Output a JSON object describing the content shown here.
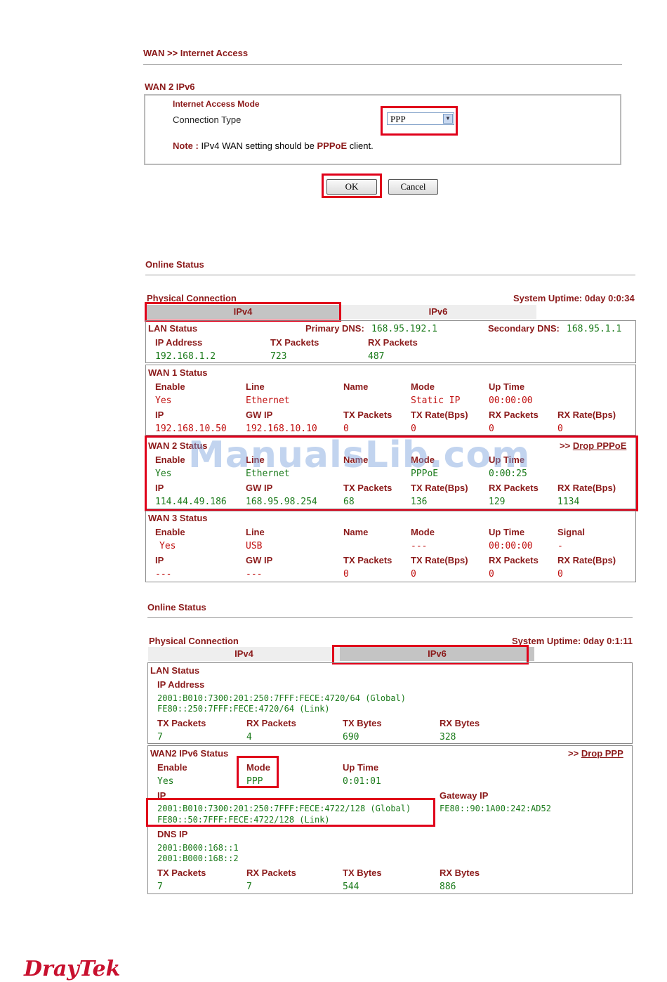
{
  "section1": {
    "breadcrumb": "WAN >> Internet Access",
    "title": "WAN 2 IPv6",
    "mode_header": "Internet Access Mode",
    "connection_type_label": "Connection Type",
    "connection_type_value": "PPP",
    "note_label": "Note :",
    "note_pre": "IPv4 WAN setting should be",
    "note_bold": "PPPoE",
    "note_post": "client.",
    "ok_label": "OK",
    "cancel_label": "Cancel"
  },
  "status1": {
    "title": "Online Status",
    "physical_connection": "Physical Connection",
    "uptime": "System Uptime: 0day 0:0:34",
    "tab_ipv4": "IPv4",
    "tab_ipv6": "IPv6",
    "lan": {
      "title": "LAN Status",
      "primary_dns_label": "Primary DNS:",
      "primary_dns": "168.95.192.1",
      "secondary_dns_label": "Secondary DNS:",
      "secondary_dns": "168.95.1.1",
      "headers": [
        "IP Address",
        "TX Packets",
        "RX Packets"
      ],
      "values": [
        "192.168.1.2",
        "723",
        "487"
      ]
    },
    "wan1": {
      "title": "WAN 1 Status",
      "h1": [
        "Enable",
        "Line",
        "Name",
        "Mode",
        "Up Time"
      ],
      "v1": [
        "Yes",
        "Ethernet",
        "",
        "Static IP",
        "00:00:00"
      ],
      "h2": [
        "IP",
        "GW IP",
        "TX Packets",
        "TX Rate(Bps)",
        "RX Packets",
        "RX Rate(Bps)"
      ],
      "v2": [
        "192.168.10.50",
        "192.168.10.10",
        "0",
        "0",
        "0",
        "0"
      ]
    },
    "wan2": {
      "title": "WAN 2 Status",
      "drop_prefix": ">>",
      "drop_link": "Drop PPPoE",
      "h1": [
        "Enable",
        "Line",
        "Name",
        "Mode",
        "Up Time"
      ],
      "v1": [
        "Yes",
        "Ethernet",
        "",
        "PPPoE",
        "0:00:25"
      ],
      "h2": [
        "IP",
        "GW IP",
        "TX Packets",
        "TX Rate(Bps)",
        "RX Packets",
        "RX Rate(Bps)"
      ],
      "v2": [
        "114.44.49.186",
        "168.95.98.254",
        "68",
        "136",
        "129",
        "1134"
      ]
    },
    "wan3": {
      "title": "WAN 3 Status",
      "h1": [
        "Enable",
        "Line",
        "Name",
        "Mode",
        "Up Time",
        "Signal"
      ],
      "v1": [
        "Yes",
        "USB",
        "",
        "---",
        "00:00:00",
        "-"
      ],
      "h2": [
        "IP",
        "GW IP",
        "TX Packets",
        "TX Rate(Bps)",
        "RX Packets",
        "RX Rate(Bps)"
      ],
      "v2": [
        "---",
        "---",
        "0",
        "0",
        "0",
        "0"
      ]
    }
  },
  "status2": {
    "title": "Online Status",
    "physical_connection": "Physical Connection",
    "uptime": "System Uptime: 0day 0:1:11",
    "tab_ipv4": "IPv4",
    "tab_ipv6": "IPv6",
    "lan": {
      "title": "LAN Status",
      "ip_header": "IP Address",
      "ip_global": "2001:B010:7300:201:250:7FFF:FECE:4720/64 (Global)",
      "ip_link": "FE80::250:7FFF:FECE:4720/64 (Link)",
      "headers": [
        "TX Packets",
        "RX Packets",
        "TX Bytes",
        "RX Bytes"
      ],
      "values": [
        "7",
        "4",
        "690",
        "328"
      ]
    },
    "wan2": {
      "title": "WAN2 IPv6 Status",
      "drop_prefix": ">>",
      "drop_link": "Drop PPP",
      "h1": [
        "Enable",
        "Mode",
        "Up Time"
      ],
      "v1": [
        "Yes",
        "PPP",
        "0:01:01"
      ],
      "ip_header": "IP",
      "gateway_header": "Gateway IP",
      "ip_global": "2001:B010:7300:201:250:7FFF:FECE:4722/128 (Global)",
      "ip_link": "FE80::50:7FFF:FECE:4722/128 (Link)",
      "gateway": "FE80::90:1A00:242:AD52",
      "dns_header": "DNS IP",
      "dns1": "2001:B000:168::1",
      "dns2": "2001:B000:168::2",
      "headers": [
        "TX Packets",
        "RX Packets",
        "TX Bytes",
        "RX Bytes"
      ],
      "values": [
        "7",
        "7",
        "544",
        "886"
      ]
    }
  },
  "watermark": "ManualsLib.com",
  "logo": "DrayTek"
}
